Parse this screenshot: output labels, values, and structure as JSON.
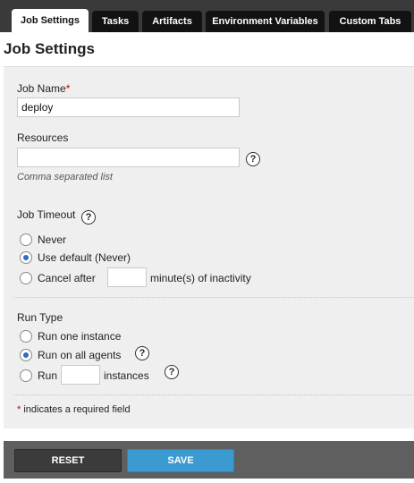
{
  "tabs": [
    {
      "label": "Job Settings",
      "active": true
    },
    {
      "label": "Tasks",
      "active": false
    },
    {
      "label": "Artifacts",
      "active": false
    },
    {
      "label": "Environment Variables",
      "active": false
    },
    {
      "label": "Custom Tabs",
      "active": false
    }
  ],
  "page_title": "Job Settings",
  "form": {
    "job_name": {
      "label": "Job Name",
      "required_mark": "*",
      "value": "deploy"
    },
    "resources": {
      "label": "Resources",
      "value": "",
      "hint": "Comma separated list",
      "help_icon": "?"
    },
    "job_timeout": {
      "label": "Job Timeout",
      "help_icon": "?",
      "options": {
        "never": "Never",
        "use_default": "Use default (Never)",
        "cancel_after_prefix": "Cancel after",
        "cancel_after_suffix": "minute(s) of inactivity"
      },
      "selected": "use_default",
      "cancel_after_value": ""
    },
    "run_type": {
      "label": "Run Type",
      "options": {
        "one_instance": "Run one instance",
        "all_agents": "Run on all agents",
        "run_prefix": "Run",
        "run_suffix": "instances"
      },
      "selected": "all_agents",
      "instances_value": "",
      "help_icon": "?"
    },
    "required_note": {
      "mark": "*",
      "text": " indicates a required field"
    }
  },
  "footer": {
    "reset_label": "RESET",
    "save_label": "SAVE"
  },
  "colors": {
    "tabbar": "#3a3a3a",
    "tab": "#121212",
    "panel": "#efefef",
    "save": "#3b9ad0",
    "reset": "#3b3b3b",
    "required": "#cc0000"
  }
}
